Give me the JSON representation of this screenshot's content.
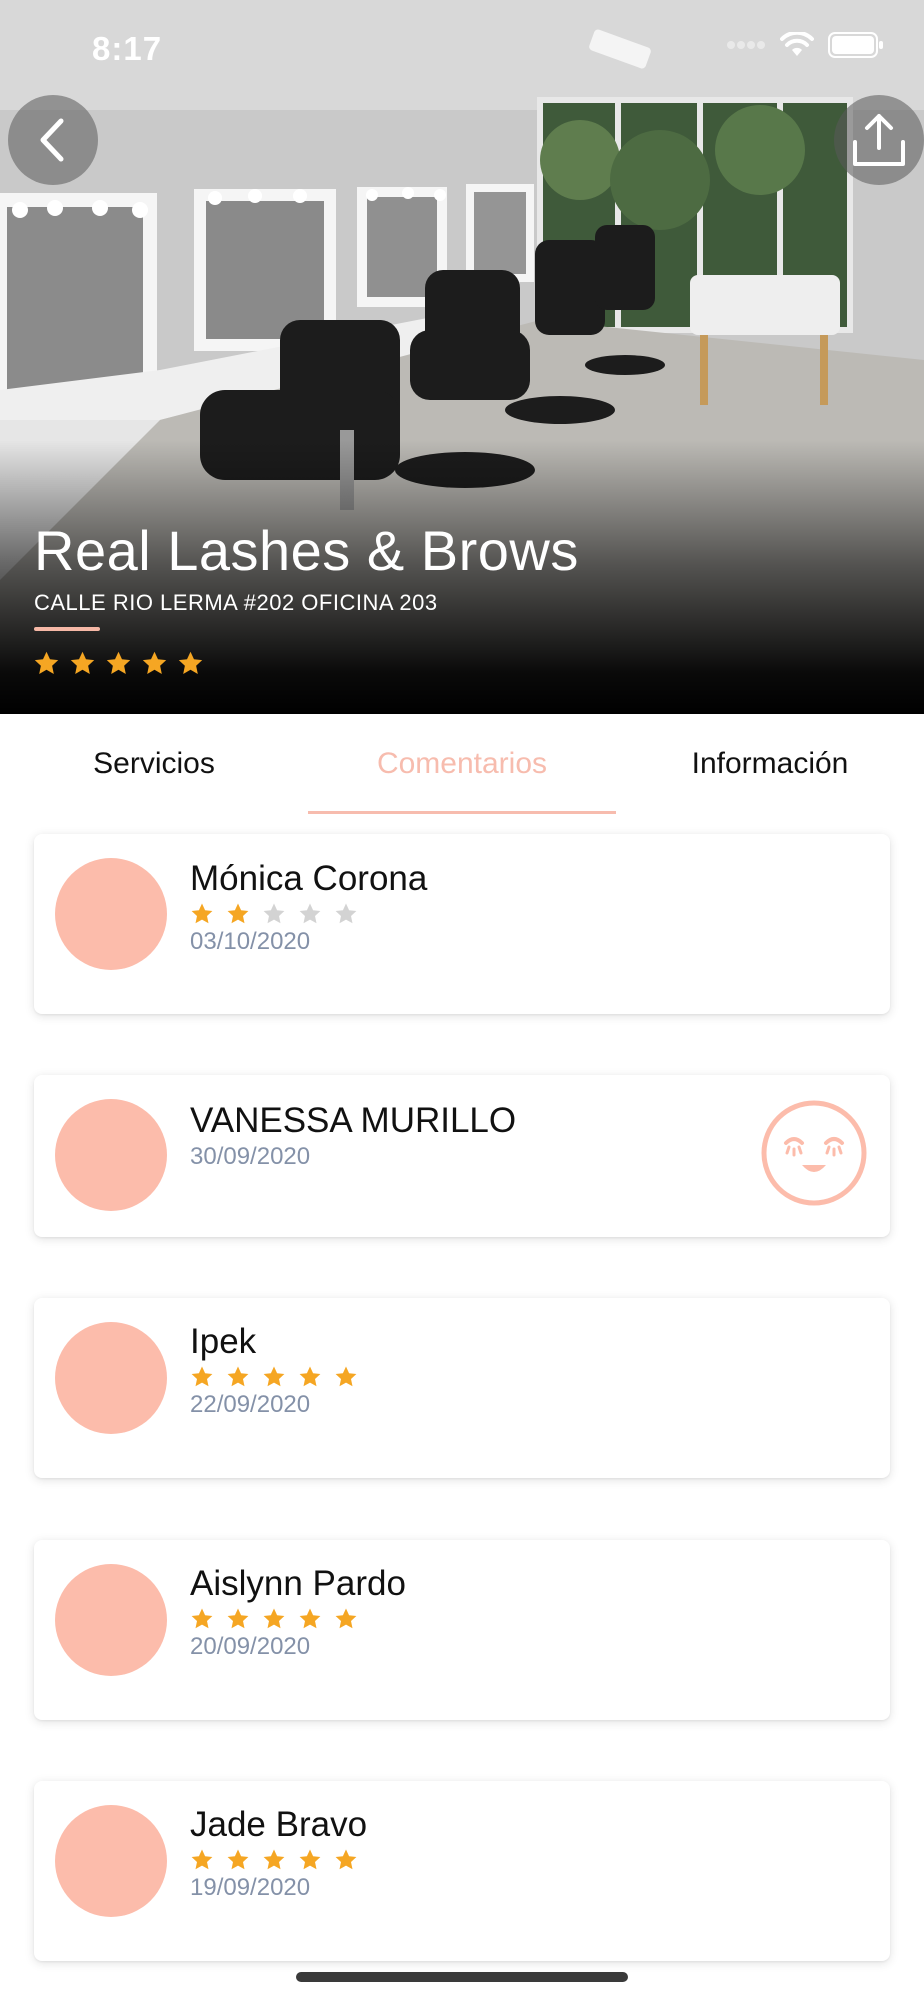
{
  "status_bar": {
    "time": "8:17"
  },
  "business": {
    "name": "Real Lashes & Brows",
    "address": "CALLE RIO LERMA #202 OFICINA 203",
    "rating": 5
  },
  "icons": {
    "back": "chevron-left-icon",
    "share": "share-upload-icon",
    "mood": "happy-face-icon"
  },
  "colors": {
    "accent": "#f7bcae",
    "avatar": "#fcbcab",
    "star_filled": "#f5a623",
    "star_empty": "#d3d3d3",
    "date": "#8491a8"
  },
  "tabs": [
    {
      "label": "Servicios",
      "active": false
    },
    {
      "label": "Comentarios",
      "active": true
    },
    {
      "label": "Información",
      "active": false
    }
  ],
  "reviews": [
    {
      "name": "Mónica Corona",
      "rating": 2,
      "date": "03/10/2020"
    },
    {
      "name": "VANESSA MURILLO",
      "rating": null,
      "date": "30/09/2020"
    },
    {
      "name": "Ipek",
      "rating": 5,
      "date": "22/09/2020"
    },
    {
      "name": "Aislynn Pardo",
      "rating": 5,
      "date": "20/09/2020"
    },
    {
      "name": "Jade Bravo",
      "rating": 5,
      "date": "19/09/2020"
    }
  ]
}
